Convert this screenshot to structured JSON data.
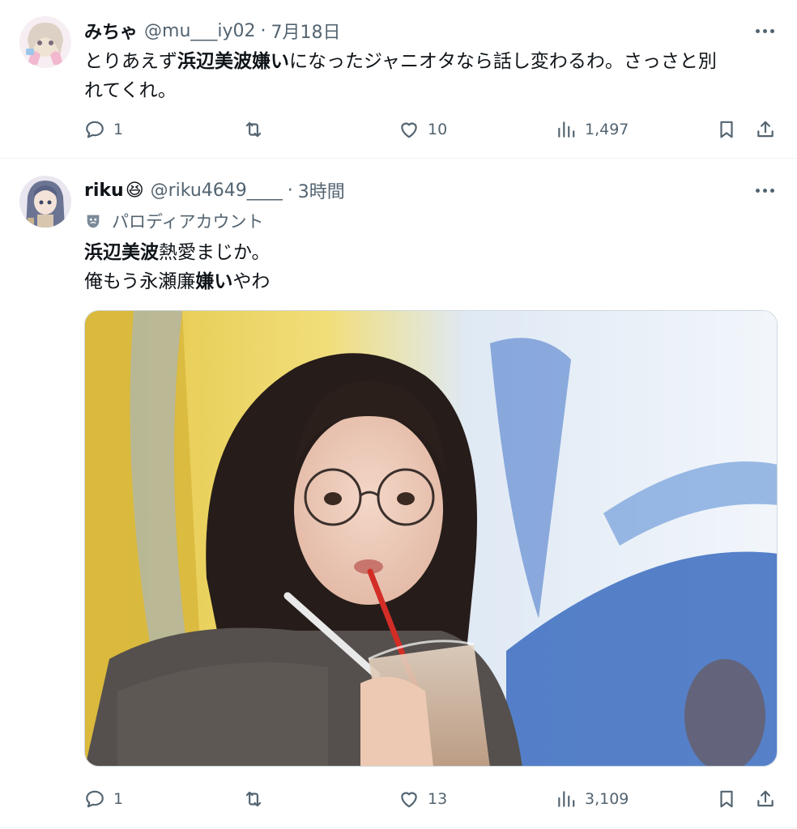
{
  "tweet1": {
    "name": "みちゃ",
    "handle": "@mu___iy02",
    "dot": "·",
    "time": "7月18日",
    "text_a": "とりあえず",
    "text_b": "浜辺美波嫌い",
    "text_c": "になったジャニオタなら話し変わるわ。さっさと別",
    "text_d": "れてくれ。",
    "replies": "1",
    "retweets": "",
    "likes": "10",
    "views": "1,497"
  },
  "tweet2": {
    "name": "riku",
    "name_emoji": "😆",
    "handle": "@riku4649____",
    "dot": "·",
    "time": "3時間",
    "parody_label": "パロディアカウント",
    "line1_bold": "浜辺美波",
    "line1_rest": "熱愛まじか。",
    "line2_a": "俺もう永瀬廉",
    "line2_bold": "嫌い",
    "line2_c": "やわ",
    "replies": "1",
    "retweets": "",
    "likes": "13",
    "views": "3,109"
  },
  "icons": {
    "reply": "reply-icon",
    "retweet": "retweet-icon",
    "like": "heart-icon",
    "views": "views-icon",
    "bookmark": "bookmark-icon",
    "share": "share-icon",
    "more": "more-icon",
    "parody": "theater-mask-icon"
  },
  "colors": {
    "text": "#0f1419",
    "muted": "#536471",
    "divider": "#eff3f4"
  }
}
